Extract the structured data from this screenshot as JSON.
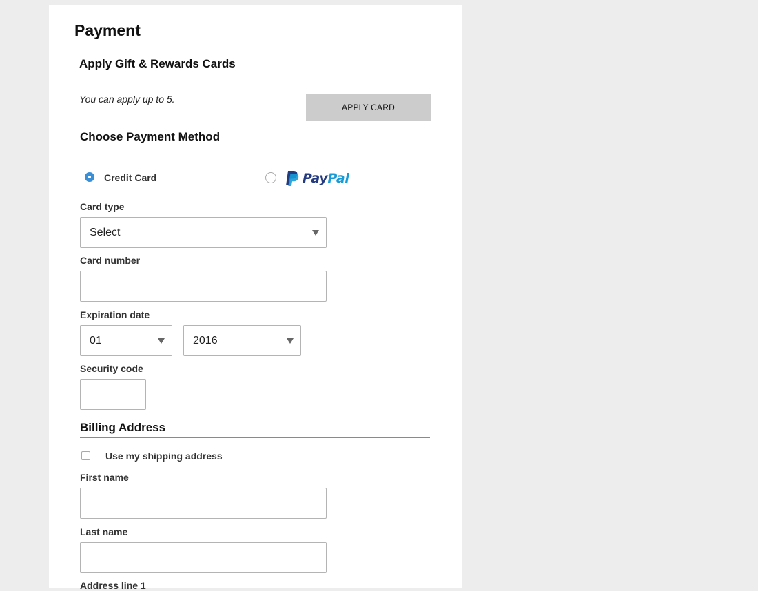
{
  "page": {
    "title": "Payment"
  },
  "gift_cards": {
    "title": "Apply Gift & Rewards Cards",
    "hint": "You can apply up to 5.",
    "apply_button_label": "APPLY CARD"
  },
  "payment_method": {
    "title": "Choose Payment Method",
    "options": [
      {
        "label": "Credit Card",
        "selected": true
      },
      {
        "label": "PayPal",
        "brand_part1": "Pay",
        "brand_part2": "Pal",
        "selected": false
      }
    ],
    "brand_colors": {
      "pay": "#253b80",
      "pal": "#179bd7"
    }
  },
  "card_form": {
    "card_type": {
      "label": "Card type",
      "value": "Select"
    },
    "card_number": {
      "label": "Card number",
      "value": ""
    },
    "expiration": {
      "label": "Expiration date",
      "month": "01",
      "year": "2016"
    },
    "security_code": {
      "label": "Security code",
      "value": ""
    }
  },
  "billing": {
    "title": "Billing Address",
    "use_shipping_label": "Use my shipping address",
    "use_shipping_checked": false,
    "first_name": {
      "label": "First name",
      "value": ""
    },
    "last_name": {
      "label": "Last name",
      "value": ""
    },
    "address_line_1": {
      "label": "Address line 1"
    }
  },
  "colors": {
    "page_background": "#ededed",
    "panel_background": "#ffffff",
    "button_background": "#cccccc",
    "radio_selected": "#3a8fd9"
  }
}
